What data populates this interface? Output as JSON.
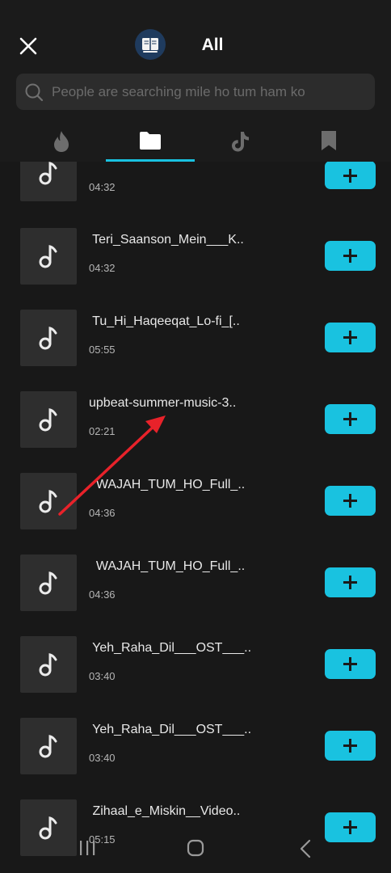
{
  "header": {
    "title": "All",
    "close_icon": "close-icon",
    "logo_icon": "book-logo-icon"
  },
  "search": {
    "placeholder": "People are searching mile ho tum ham ko",
    "value": ""
  },
  "tabs": [
    {
      "icon": "flame-icon",
      "selected": false
    },
    {
      "icon": "folder-icon",
      "selected": true
    },
    {
      "icon": "tiktok-icon",
      "selected": false
    },
    {
      "icon": "bookmark-icon",
      "selected": false
    }
  ],
  "colors": {
    "accent": "#19c2e0",
    "background": "#181818",
    "thumbnail": "#2e2e2e",
    "search_bg": "#2c2c2c",
    "annotation_arrow": "#e8222a"
  },
  "tracks": [
    {
      "title": "",
      "duration": "04:32"
    },
    {
      "title": " Teri_Saanson_Mein___K..",
      "duration": "04:32"
    },
    {
      "title": " Tu_Hi_Haqeeqat_Lo-fi_[..",
      "duration": "05:55"
    },
    {
      "title": "upbeat-summer-music-3..",
      "duration": "02:21"
    },
    {
      "title": "  WAJAH_TUM_HO_Full_..",
      "duration": "04:36"
    },
    {
      "title": "  WAJAH_TUM_HO_Full_..",
      "duration": "04:36"
    },
    {
      "title": " Yeh_Raha_Dil___OST___..",
      "duration": "03:40"
    },
    {
      "title": " Yeh_Raha_Dil___OST___..",
      "duration": "03:40"
    },
    {
      "title": " Zihaal_e_Miskin__Video..",
      "duration": "05:15"
    }
  ],
  "system_nav": [
    "recent-apps-icon",
    "home-icon",
    "back-icon"
  ]
}
